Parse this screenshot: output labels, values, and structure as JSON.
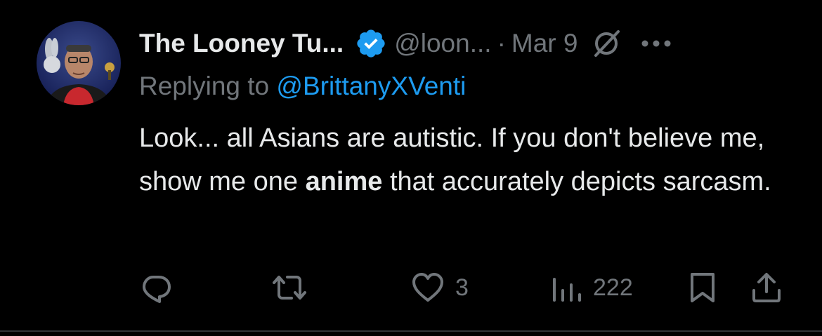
{
  "author": {
    "display_name": "The Looney Tu...",
    "handle": "@loon...",
    "separator": "·",
    "date": "Mar 9",
    "verified_color": "#1d9bf0",
    "verified_icon": "verified-badge-icon"
  },
  "reply": {
    "prefix": "Replying to",
    "handle": "@BrittanyXVenti"
  },
  "post": {
    "text_1": "Look... all Asians are autistic.  If you don't believe me, show me one ",
    "text_bold": "anime",
    "text_2": " that accurately depicts sarcasm."
  },
  "actions": {
    "reply_icon": "reply-icon",
    "repost_icon": "repost-icon",
    "like_icon": "heart-icon",
    "like_count": "3",
    "views_icon": "views-icon",
    "views_count": "222",
    "bookmark_icon": "bookmark-icon",
    "share_icon": "share-icon"
  },
  "colors": {
    "background": "#000000",
    "text": "#e7e9ea",
    "muted": "#71767b",
    "link": "#1d9bf0"
  }
}
